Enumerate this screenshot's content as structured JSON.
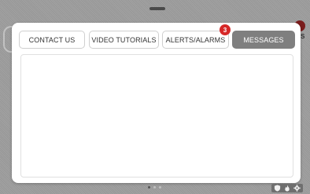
{
  "tabs": {
    "contact_us": "CONTACT US",
    "video_tutorials": "VIDEO TUTORIALS",
    "alerts_alarms": "ALERTS/ALARMS",
    "messages": "MESSAGES"
  },
  "active_tab": "messages",
  "alerts_badge_count": "3",
  "background_label": "S",
  "page_indicator": {
    "count": 3,
    "active_index": 0
  },
  "icons": [
    "shield-icon",
    "flame-icon",
    "gear-icon"
  ],
  "colors": {
    "active_tab": "#7f7f7f",
    "badge": "#d62828",
    "backdrop": "#9a9a9a"
  }
}
